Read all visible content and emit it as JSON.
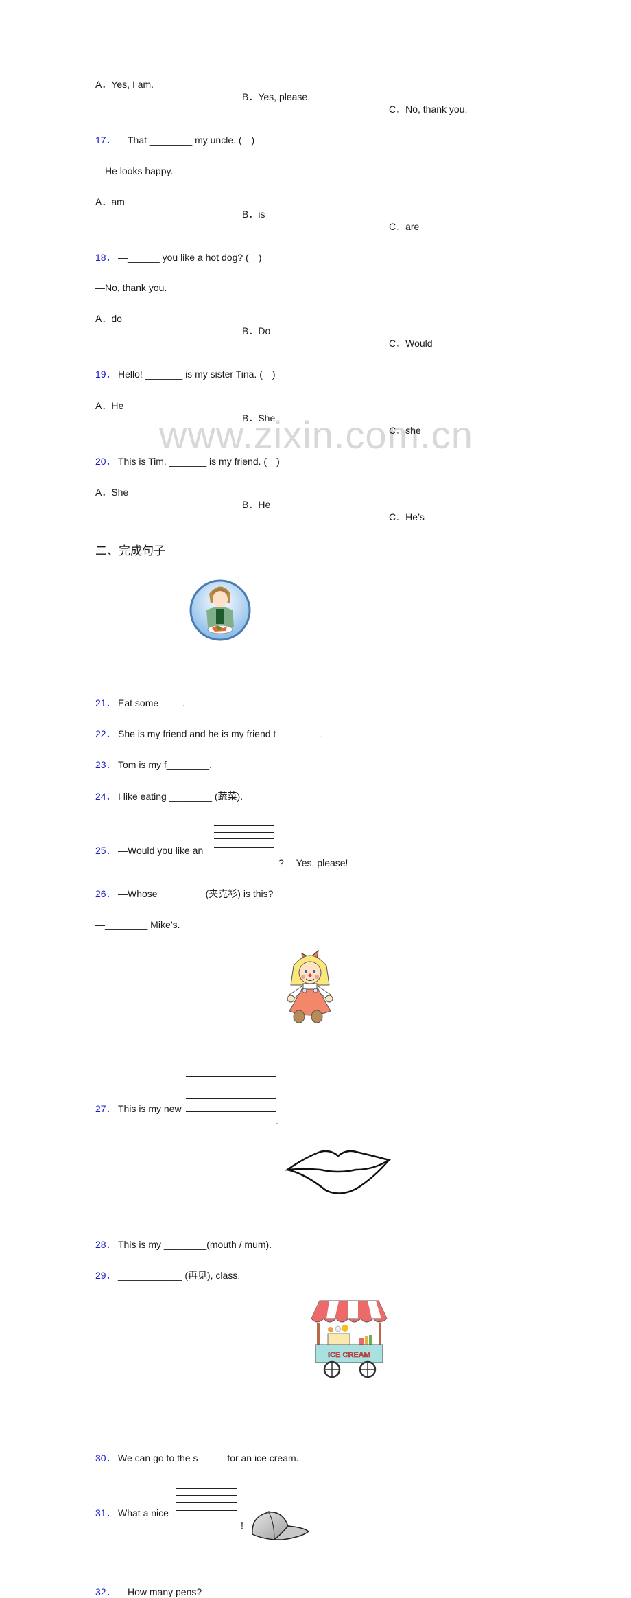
{
  "watermark": "www.zixin.com.cn",
  "section_two_heading": "二、完成句子",
  "q16_options": {
    "a": "A．Yes, I am.",
    "b": "B．Yes, please.",
    "c": "C．No, thank you."
  },
  "questions": [
    {
      "num": "17．",
      "text": "—That ________ my uncle. (　)",
      "reply": "—He looks happy.",
      "options": {
        "a": "A．am",
        "b": "B．is",
        "c": "C．are"
      }
    },
    {
      "num": "18．",
      "text": "—______ you like a hot dog? (　)",
      "reply": "—No, thank you.",
      "options": {
        "a": "A．do",
        "b": "B．Do",
        "c": "C．Would"
      }
    },
    {
      "num": "19．",
      "text": "Hello! _______ is my sister Tina. (　)",
      "options": {
        "a": "A．He",
        "b": "B．She",
        "c": "C．she"
      }
    },
    {
      "num": "20．",
      "text": "This is Tim. _______ is my friend. (　)",
      "options": {
        "a": "A．She",
        "b": "B．He",
        "c": "C．He’s"
      }
    },
    {
      "num": "21．",
      "text": "Eat some ____."
    },
    {
      "num": "22．",
      "text": "She is my friend and he is my friend t________."
    },
    {
      "num": "23．",
      "text": "Tom is my f________."
    },
    {
      "num": "24．",
      "text": "I like eating ________ (蔬菜)."
    },
    {
      "num": "25．",
      "text": "—Would you like an",
      "after": "? —Yes, please!"
    },
    {
      "num": "26．",
      "text": "—Whose ________ (夹克衫) is this?",
      "reply": "—________ Mike’s."
    },
    {
      "num": "27．",
      "text": "This is my new",
      "after": "."
    },
    {
      "num": "28．",
      "text": "This is my ________(mouth / mum)."
    },
    {
      "num": "29．",
      "text": "____________ (再见), class."
    },
    {
      "num": "30．",
      "text": "We can go to the s_____ for an ice cream."
    },
    {
      "num": "31．",
      "text": "What a nice",
      "after": "!"
    },
    {
      "num": "32．",
      "text": "—How many pens?"
    }
  ],
  "images": {
    "girl_eating": "girl-eating-food-illustration",
    "doll": "doll-illustration",
    "lips": "lips-drawing",
    "ice_cream_cart": "ice-cream-cart-illustration",
    "ice_cream_cart_sign": "ICE CREAM",
    "cap": "cap-illustration"
  }
}
